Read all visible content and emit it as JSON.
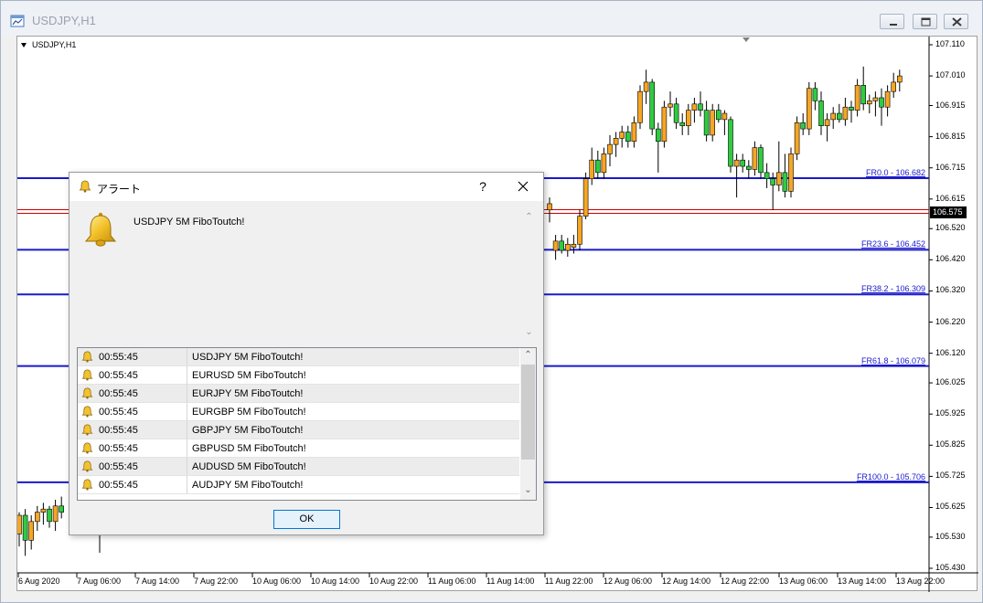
{
  "window": {
    "title": "USDJPY,H1",
    "buttons": [
      "minimize",
      "restore",
      "close"
    ]
  },
  "chart": {
    "symbol_label": "USDJPY,H1",
    "current_price": "106.575",
    "colors": {
      "bull": "#f5a623",
      "bear": "#2ecc40",
      "fibo": "#1a1acc",
      "price_line": "#cc0000"
    },
    "price_ticks": [
      "107.110",
      "107.010",
      "106.915",
      "106.815",
      "106.715",
      "106.615",
      "106.520",
      "106.420",
      "106.320",
      "106.220",
      "106.120",
      "106.025",
      "105.925",
      "105.825",
      "105.725",
      "105.625",
      "105.530",
      "105.430"
    ],
    "time_ticks": [
      "6 Aug 2020",
      "7 Aug 06:00",
      "7 Aug 14:00",
      "7 Aug 22:00",
      "10 Aug 06:00",
      "10 Aug 14:00",
      "10 Aug 22:00",
      "11 Aug 06:00",
      "11 Aug 14:00",
      "11 Aug 22:00",
      "12 Aug 06:00",
      "12 Aug 14:00",
      "12 Aug 22:00",
      "13 Aug 06:00",
      "13 Aug 14:00",
      "13 Aug 22:00"
    ],
    "fibo_levels": [
      {
        "label": "FR0.0 - 106.682",
        "price": 106.682
      },
      {
        "label": "FR23.6 - 106.452",
        "price": 106.452
      },
      {
        "label": "FR38.2 - 106.309",
        "price": 106.309
      },
      {
        "label": "FR61.8 - 106.079",
        "price": 106.079
      },
      {
        "label": "FR100.0 - 105.706",
        "price": 105.706
      }
    ]
  },
  "dialog": {
    "title": "アラート",
    "help_label": "?",
    "message": "USDJPY 5M FiboToutch!",
    "alerts": [
      {
        "time": "00:55:45",
        "message": "USDJPY 5M FiboToutch!"
      },
      {
        "time": "00:55:45",
        "message": "EURUSD 5M FiboToutch!"
      },
      {
        "time": "00:55:45",
        "message": "EURJPY 5M FiboToutch!"
      },
      {
        "time": "00:55:45",
        "message": "EURGBP 5M FiboToutch!"
      },
      {
        "time": "00:55:45",
        "message": "GBPJPY 5M FiboToutch!"
      },
      {
        "time": "00:55:45",
        "message": "GBPUSD 5M FiboToutch!"
      },
      {
        "time": "00:55:45",
        "message": "AUDUSD 5M FiboToutch!"
      },
      {
        "time": "00:55:45",
        "message": "AUDJPY 5M FiboToutch!"
      }
    ],
    "ok_label": "OK"
  }
}
